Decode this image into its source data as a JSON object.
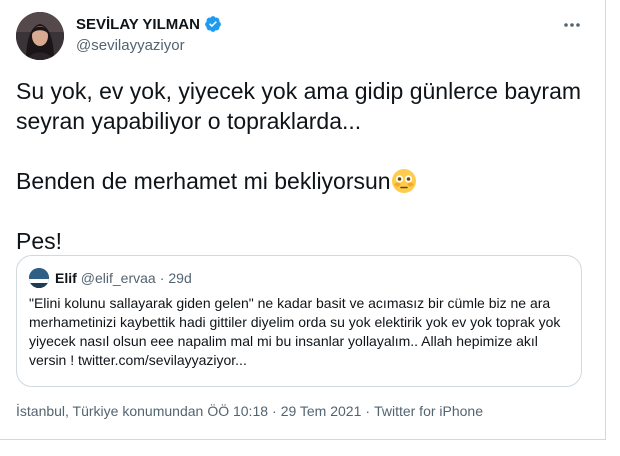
{
  "author": {
    "display_name": "SEVİLAY YILMAN",
    "handle": "@sevilayyaziyor",
    "verified": true,
    "avatar": "profile-photo"
  },
  "menu": {
    "icon": "more-horizontal-icon"
  },
  "tweet": {
    "line1": "Su yok, ev yok, yiyecek yok ama gidip günlerce bayram seyran yapabiliyor o topraklarda...",
    "line2": "Benden de merhamet mi bekliyorsun",
    "emoji": "flushed-face-emoji",
    "line3": "Pes!"
  },
  "quote": {
    "name": "Elif",
    "handle": "@elif_ervaa",
    "dot": "·",
    "date": "29d",
    "text": "\"Elini kolunu sallayarak giden gelen\" ne kadar basit ve acımasız bir cümle  biz ne ara merhametinizi kaybettik hadi gittiler diyelim orda su yok elektirik yok ev yok toprak yok yiyecek nasıl olsun eee napalim mal mi bu insanlar yollayalım.. Allah hepimize akıl versin ! twitter.com/sevilayyaziyor..."
  },
  "meta": {
    "location": "İstanbul, Türkiye konumundan",
    "time": "ÖÖ 10:18",
    "dot": "·",
    "date": "29 Tem 2021",
    "source": "Twitter for iPhone"
  },
  "colors": {
    "text": "#0f1419",
    "secondary": "#536471",
    "border": "#cfd9de",
    "verified": "#1d9bf0"
  }
}
